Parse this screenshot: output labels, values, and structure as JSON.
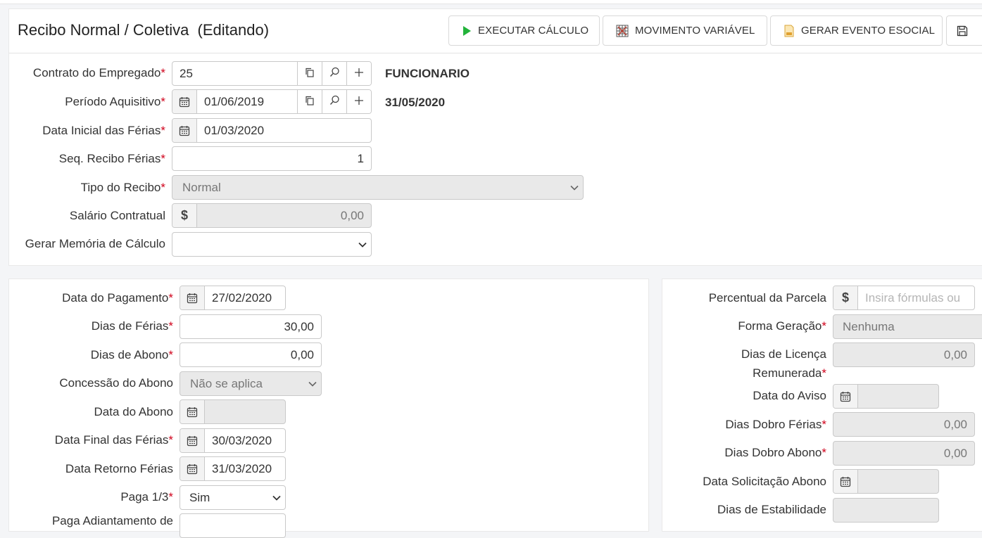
{
  "header": {
    "title": "Recibo Normal / Coletiva  (Editando)",
    "buttons": {
      "executar": "EXECUTAR CÁLCULO",
      "movimento": "MOVIMENTO VARIÁVEL",
      "gerar_esocial": "GERAR EVENTO ESOCIAL"
    }
  },
  "form1": {
    "contrato": {
      "label": "Contrato do Empregado",
      "value": "25",
      "info": "FUNCIONARIO"
    },
    "periodo": {
      "label": "Período Aquisitivo",
      "value": "01/06/2019",
      "info": "31/05/2020"
    },
    "data_inicial": {
      "label": "Data Inicial das Férias",
      "value": "01/03/2020"
    },
    "seq_recibo": {
      "label": "Seq. Recibo Férias",
      "value": "1"
    },
    "tipo_recibo": {
      "label": "Tipo do Recibo",
      "value": "Normal"
    },
    "salario": {
      "label": "Salário Contratual",
      "value": "0,00"
    },
    "memoria": {
      "label": "Gerar Memória de Cálculo",
      "value": ""
    }
  },
  "form2": {
    "data_pagamento": {
      "label": "Data do Pagamento",
      "value": "27/02/2020"
    },
    "dias_ferias": {
      "label": "Dias de Férias",
      "value": "30,00"
    },
    "dias_abono": {
      "label": "Dias de Abono",
      "value": "0,00"
    },
    "concessao_abono": {
      "label": "Concessão do Abono",
      "value": "Não se aplica"
    },
    "data_abono": {
      "label": "Data do Abono",
      "value": ""
    },
    "data_final": {
      "label": "Data Final das Férias",
      "value": "30/03/2020"
    },
    "data_retorno": {
      "label": "Data Retorno Férias",
      "value": "31/03/2020"
    },
    "paga_terco": {
      "label": "Paga 1/3",
      "value": "Sim"
    },
    "paga_adiantamento": {
      "label": "Paga Adiantamento de"
    }
  },
  "form3": {
    "percentual": {
      "label": "Percentual da Parcela",
      "placeholder": "Insira fórmulas ou"
    },
    "forma_geracao": {
      "label": "Forma Geração",
      "value": "Nenhuma"
    },
    "dias_licenca": {
      "label_line1": "Dias de Licença",
      "label_line2": "Remunerada",
      "value": "0,00"
    },
    "data_aviso": {
      "label": "Data do Aviso",
      "value": ""
    },
    "dias_dobro_ferias": {
      "label": "Dias Dobro Férias",
      "value": "0,00"
    },
    "dias_dobro_abono": {
      "label": "Dias Dobro Abono",
      "value": "0,00"
    },
    "data_solicitacao": {
      "label": "Data Solicitação Abono",
      "value": ""
    },
    "dias_estabilidade": {
      "label": "Dias de Estabilidade",
      "value": ""
    }
  },
  "colors": {
    "required": "#d0021b",
    "play_green": "#22b33a",
    "disabled_bg": "#e9e9e9"
  },
  "icons": [
    "play-icon",
    "grid-icon",
    "esocial-doc-icon",
    "save-icon",
    "calendar-icon",
    "copy-icon",
    "search-icon",
    "plus-icon",
    "dollar-icon",
    "chevron-down-icon"
  ]
}
